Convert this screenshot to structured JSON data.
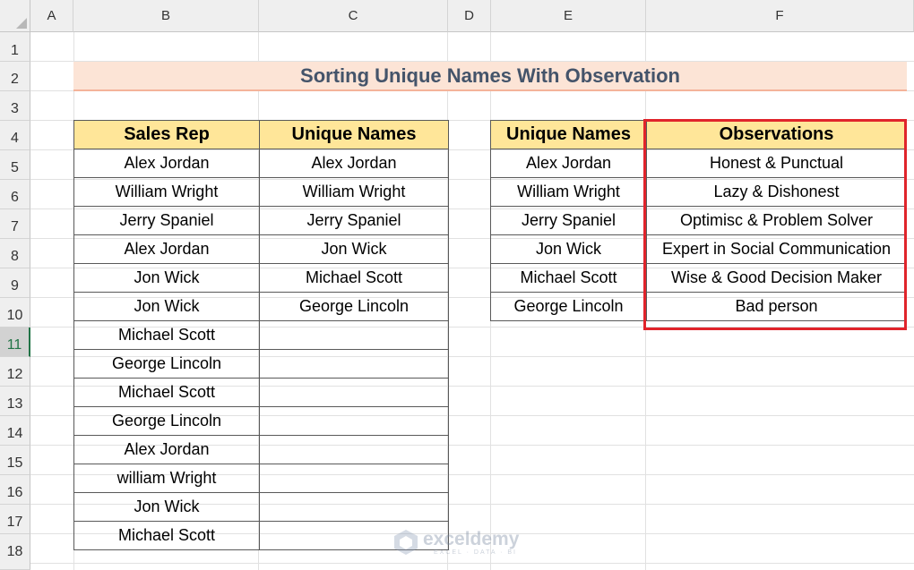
{
  "columns": [
    "A",
    "B",
    "C",
    "D",
    "E",
    "F"
  ],
  "rows": [
    "1",
    "2",
    "3",
    "4",
    "5",
    "6",
    "7",
    "8",
    "9",
    "10",
    "11",
    "12",
    "13",
    "14",
    "15",
    "16",
    "17",
    "18"
  ],
  "title": "Sorting Unique Names With Observation",
  "sales_table": {
    "headers": [
      "Sales Rep",
      "Unique Names"
    ],
    "rows": [
      [
        "Alex Jordan",
        "Alex Jordan"
      ],
      [
        "William Wright",
        "William Wright"
      ],
      [
        "Jerry Spaniel",
        "Jerry Spaniel"
      ],
      [
        "Alex Jordan",
        "Jon Wick"
      ],
      [
        "Jon Wick",
        "Michael Scott"
      ],
      [
        "Jon Wick",
        "George Lincoln"
      ],
      [
        "Michael Scott",
        ""
      ],
      [
        "George Lincoln",
        ""
      ],
      [
        "Michael Scott",
        ""
      ],
      [
        "George Lincoln",
        ""
      ],
      [
        "Alex Jordan",
        ""
      ],
      [
        "william Wright",
        ""
      ],
      [
        "Jon Wick",
        ""
      ],
      [
        "Michael Scott",
        ""
      ]
    ]
  },
  "obs_table": {
    "headers": [
      "Unique Names",
      "Observations"
    ],
    "rows": [
      [
        "Alex Jordan",
        "Honest & Punctual"
      ],
      [
        "William Wright",
        "Lazy & Dishonest"
      ],
      [
        "Jerry Spaniel",
        "Optimisc & Problem Solver"
      ],
      [
        "Jon Wick",
        "Expert in Social Communication"
      ],
      [
        "Michael Scott",
        "Wise & Good Decision Maker"
      ],
      [
        "George Lincoln",
        "Bad person"
      ]
    ]
  },
  "watermark": {
    "name": "exceldemy",
    "tagline": "EXCEL · DATA · BI",
    "icon": "exceldemy-logo-icon"
  },
  "colors": {
    "title_fill": "#fce4d6",
    "header_fill": "#ffe699",
    "highlight_border": "#e0242b",
    "active_row": "#217346"
  }
}
